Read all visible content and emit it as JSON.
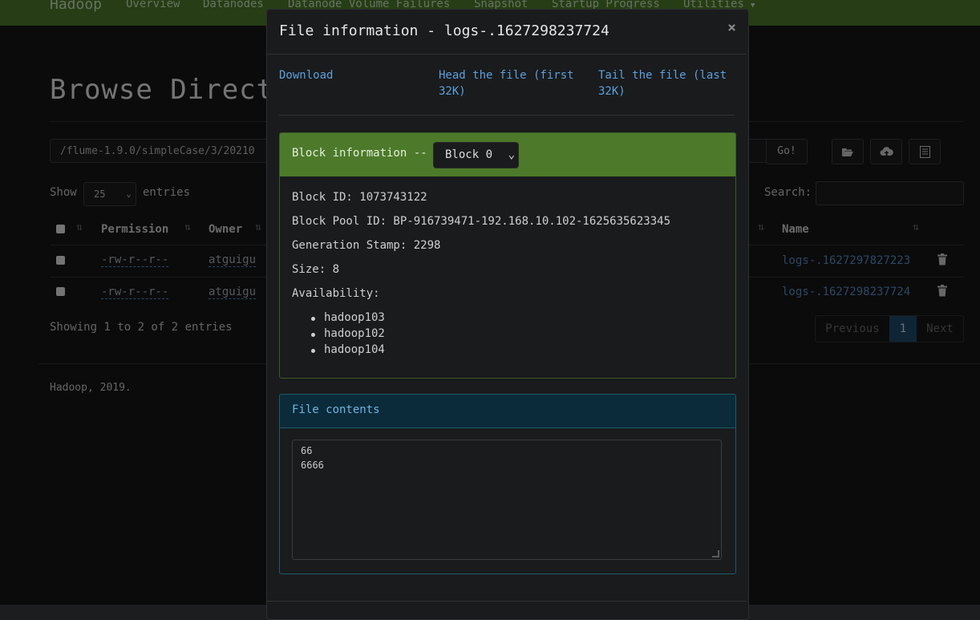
{
  "navbar": {
    "brand": "Hadoop",
    "items": [
      "Overview",
      "Datanodes",
      "Datanode Volume Failures",
      "Snapshot",
      "Startup Progress",
      "Utilities"
    ],
    "caret_icon": "caret-down-icon"
  },
  "page": {
    "title": "Browse Directory",
    "path_value": "/flume-1.9.0/simpleCase/3/20210",
    "go_label": "Go!",
    "show_label": "Show",
    "page_size": "25",
    "entries_label": "entries",
    "search_label": "Search:",
    "columns": {
      "permission": "Permission",
      "owner": "Owner",
      "name": "Name"
    },
    "rows": [
      {
        "permission": "-rw-r--r--",
        "owner": "atguigu",
        "name": "logs-.1627297827223"
      },
      {
        "permission": "-rw-r--r--",
        "owner": "atguigu",
        "name": "logs-.1627298237724"
      }
    ],
    "showing_text": "Showing 1 to 2 of 2 entries",
    "pagination": {
      "previous": "Previous",
      "current": "1",
      "next": "Next"
    },
    "footer": "Hadoop, 2019."
  },
  "modal": {
    "title": "File information - logs-.1627298237724",
    "close": "×",
    "links": {
      "download": "Download",
      "head": "Head the file (first 32K)",
      "tail": "Tail the file (last 32K)"
    },
    "block_label": "Block information --",
    "block_selected": "Block 0",
    "block_id": "Block ID: 1073743122",
    "block_pool": "Block Pool ID: BP-916739471-192.168.10.102-1625635623345",
    "gen_stamp": "Generation Stamp: 2298",
    "size": "Size: 8",
    "availability_label": "Availability:",
    "hosts": [
      "hadoop103",
      "hadoop102",
      "hadoop104"
    ],
    "contents_label": "File contents",
    "contents_lines": [
      "66",
      "6666"
    ]
  },
  "colors": {
    "navbar_green": "#4d7a2a",
    "link_blue": "#5a8fc7",
    "contents_header": "#0b2b3a"
  }
}
